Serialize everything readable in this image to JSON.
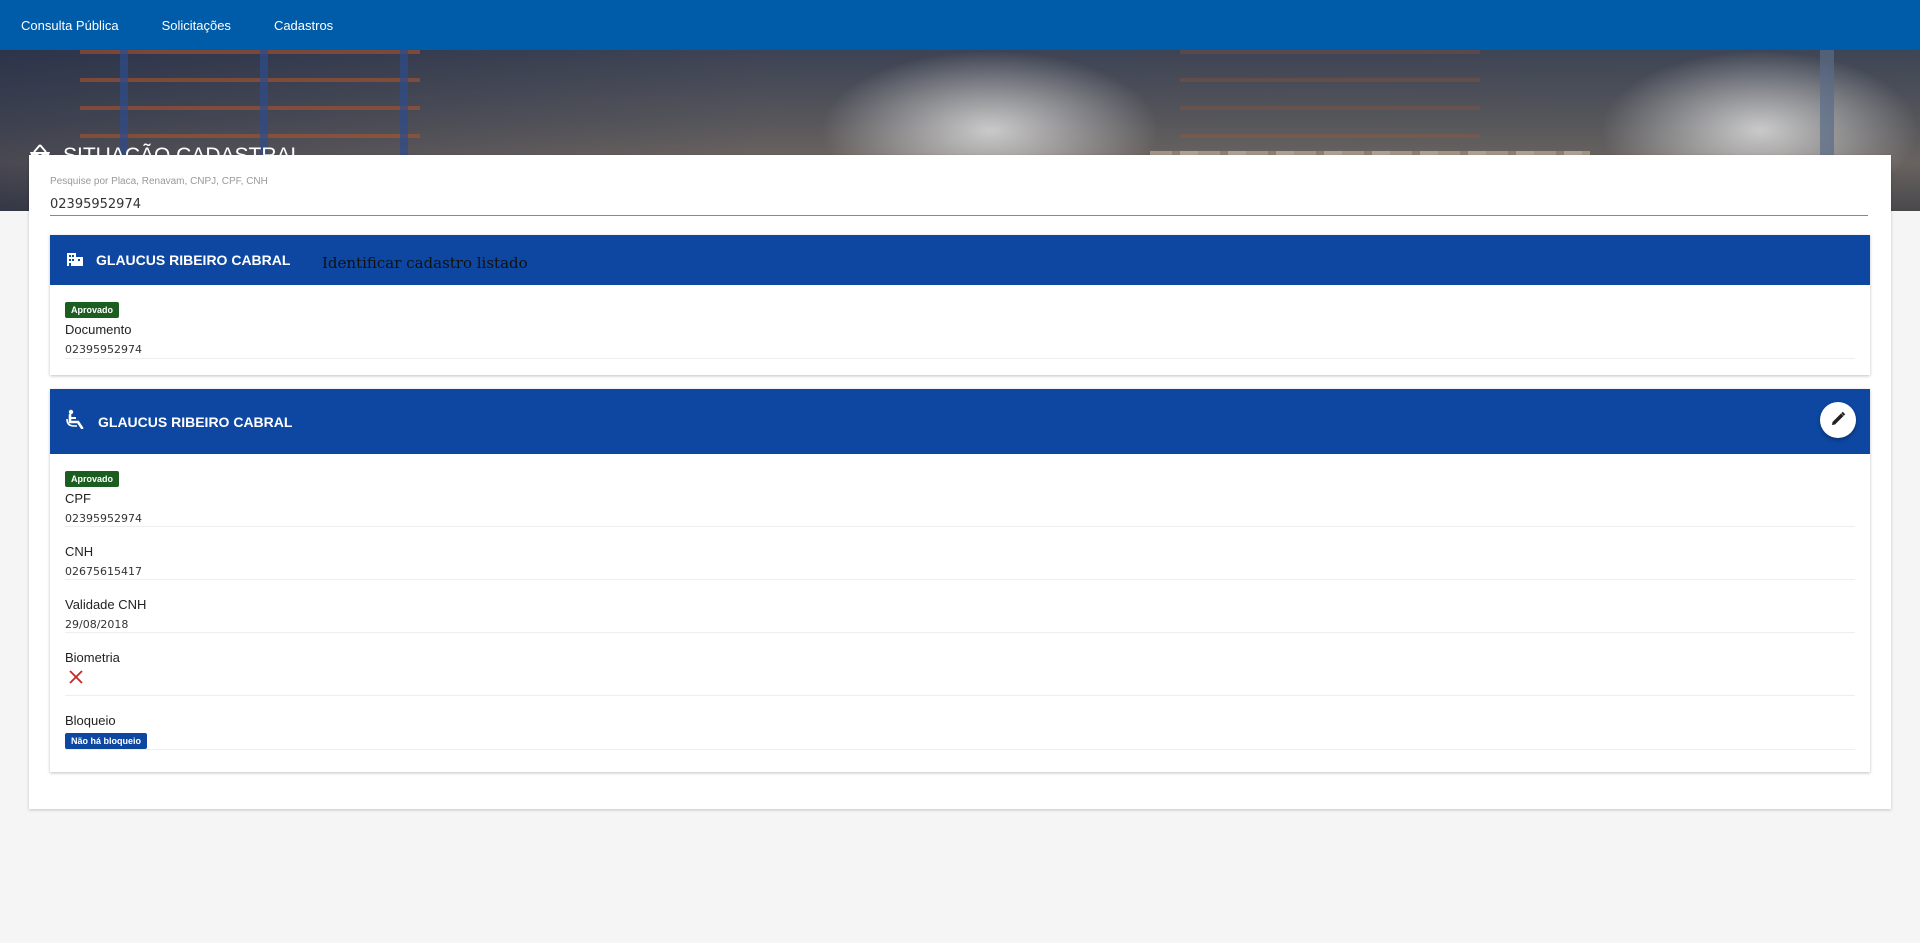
{
  "nav": {
    "items": [
      {
        "label": "Consulta Pública"
      },
      {
        "label": "Solicitações"
      },
      {
        "label": "Cadastros"
      }
    ]
  },
  "hero": {
    "title": "SITUAÇÃO CADASTRAL",
    "icon": "basket-icon"
  },
  "search": {
    "label": "Pesquise por Placa, Renavam, CNPJ, CPF, CNH",
    "value": "02395952974"
  },
  "company_card": {
    "title": "GLAUCUS RIBEIRO CABRAL",
    "icon": "building-icon",
    "hint": "Identificar cadastro listado",
    "status": "Aprovado",
    "fields": [
      {
        "label": "Documento",
        "value": "02395952974"
      }
    ]
  },
  "driver_card": {
    "title": "GLAUCUS RIBEIRO CABRAL",
    "icon": "seated-person-icon",
    "status": "Aprovado",
    "edit_icon": "pencil-icon",
    "fields": [
      {
        "label": "CPF",
        "value": "02395952974"
      },
      {
        "label": "CNH",
        "value": "02675615417"
      },
      {
        "label": "Validade CNH",
        "value": "29/08/2018"
      }
    ],
    "biometria_label": "Biometria",
    "biometria_icon": "close-icon",
    "bloqueio_label": "Bloqueio",
    "bloqueio_badge": "Não há bloqueio"
  },
  "colors": {
    "nav": "#005ba8",
    "panel_header": "#0d47a1",
    "approved": "#1b5e20",
    "error": "#c62828"
  }
}
